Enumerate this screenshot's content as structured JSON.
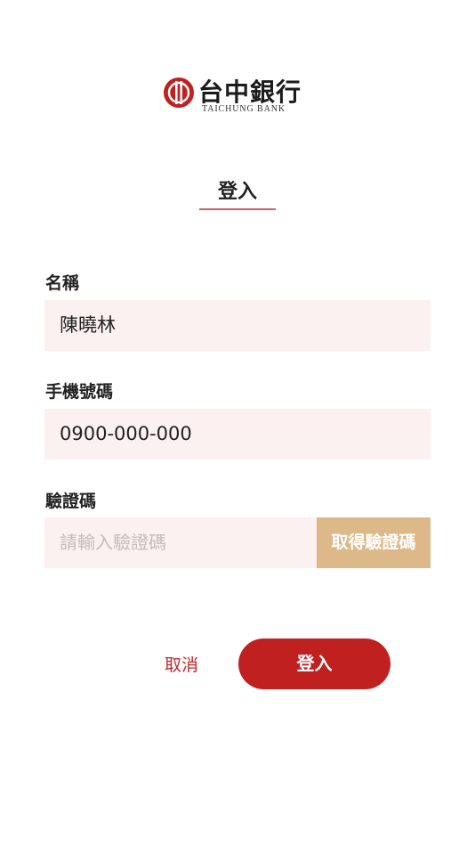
{
  "brand": {
    "name": "台中銀行",
    "subtitle": "TAICHUNG BANK",
    "logo_color": "#c0201f"
  },
  "page_title": "登入",
  "form": {
    "name": {
      "label": "名稱",
      "value": "陳曉林"
    },
    "phone": {
      "label": "手機號碼",
      "value": "0900-000-000"
    },
    "code": {
      "label": "驗證碼",
      "placeholder": "請輸入驗證碼",
      "button_label": "取得驗證碼"
    }
  },
  "actions": {
    "cancel_label": "取消",
    "login_label": "登入"
  },
  "colors": {
    "primary": "#c0201f",
    "input_bg": "#fbf1f0",
    "code_button": "#ddb98a",
    "underline": "#c9626a"
  }
}
